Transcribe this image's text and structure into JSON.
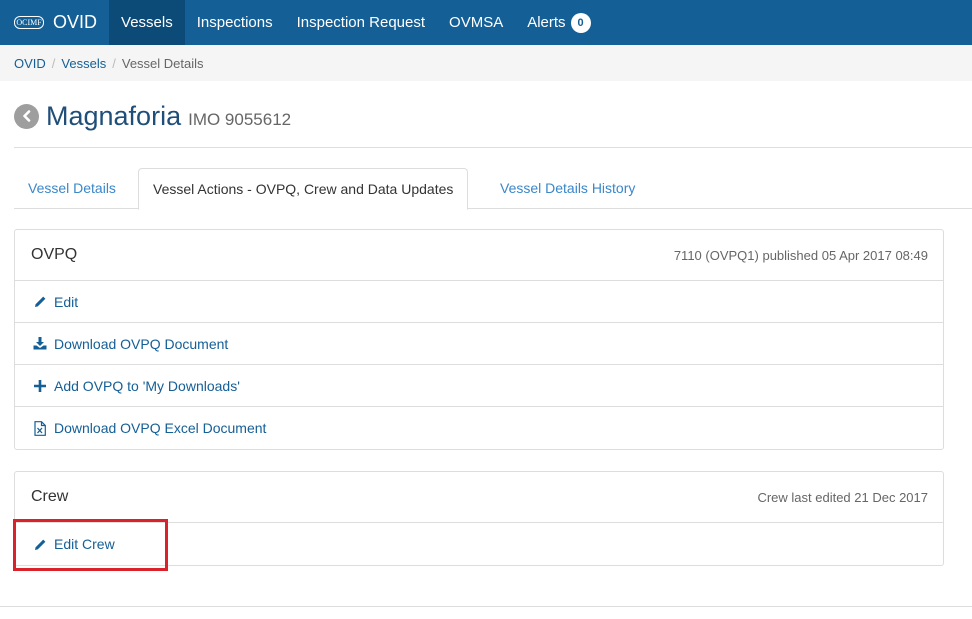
{
  "navbar": {
    "logo_text": "OCIMF",
    "brand": "OVID",
    "items": [
      {
        "label": "Vessels",
        "active": true
      },
      {
        "label": "Inspections",
        "active": false
      },
      {
        "label": "Inspection Request",
        "active": false
      },
      {
        "label": "OVMSA",
        "active": false
      },
      {
        "label": "Alerts",
        "active": false,
        "badge": "0"
      }
    ]
  },
  "breadcrumb": {
    "items": [
      "OVID",
      "Vessels"
    ],
    "current": "Vessel Details",
    "separator": "/"
  },
  "vessel": {
    "name": "Magnaforia",
    "imo": "IMO 9055612"
  },
  "tabs": [
    {
      "label": "Vessel Details",
      "active": false
    },
    {
      "label": "Vessel Actions - OVPQ, Crew and Data Updates",
      "active": true
    },
    {
      "label": "Vessel Details History",
      "active": false
    }
  ],
  "ovpq_panel": {
    "title": "OVPQ",
    "meta": "7110 (OVPQ1) published 05 Apr 2017 08:49",
    "actions": [
      {
        "label": "Edit",
        "icon": "pencil-icon"
      },
      {
        "label": "Download OVPQ Document",
        "icon": "download-icon"
      },
      {
        "label": "Add OVPQ to 'My Downloads'",
        "icon": "plus-icon"
      },
      {
        "label": "Download OVPQ Excel Document",
        "icon": "excel-file-icon"
      }
    ]
  },
  "crew_panel": {
    "title": "Crew",
    "meta": "Crew last edited 21 Dec 2017",
    "actions": [
      {
        "label": "Edit Crew",
        "icon": "pencil-icon"
      }
    ]
  },
  "colors": {
    "navbar": "#145f96",
    "navbar_active": "#0c4a77",
    "link": "#145f96",
    "highlight": "#d9222a"
  }
}
